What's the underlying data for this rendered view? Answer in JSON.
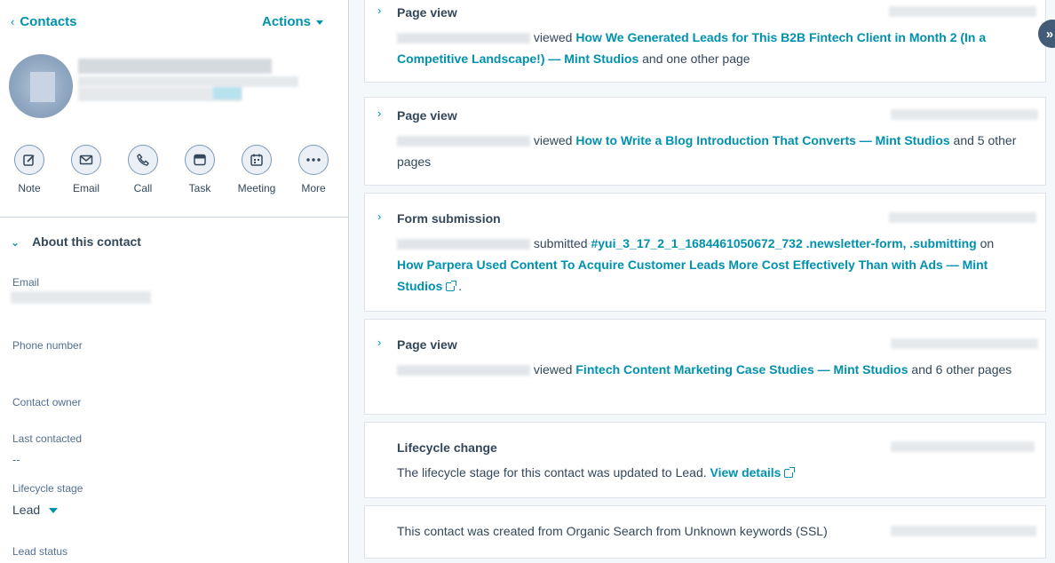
{
  "sidebar": {
    "back_label": "Contacts",
    "actions_label": "Actions",
    "activities": [
      {
        "label": "Note",
        "icon": "note-icon"
      },
      {
        "label": "Email",
        "icon": "email-icon"
      },
      {
        "label": "Call",
        "icon": "call-icon"
      },
      {
        "label": "Task",
        "icon": "task-icon"
      },
      {
        "label": "Meeting",
        "icon": "meeting-icon"
      },
      {
        "label": "More",
        "icon": "more-icon"
      }
    ],
    "about_title": "About this contact",
    "properties": {
      "email_label": "Email",
      "phone_label": "Phone number",
      "owner_label": "Contact owner",
      "last_contacted_label": "Last contacted",
      "last_contacted_value": "--",
      "lifecycle_label": "Lifecycle stage",
      "lifecycle_value": "Lead",
      "lead_status_label": "Lead status"
    }
  },
  "timeline": [
    {
      "title": "Page view",
      "verb": "viewed",
      "link": "How We Generated Leads for This B2B Fintech Client in Month 2 (In a Competitive Landscape!) — Mint Studios",
      "suffix": "and one other page"
    },
    {
      "title": "Page view",
      "verb": "viewed",
      "link": "How to Write a Blog Introduction That Converts — Mint Studios",
      "suffix": "and 5 other pages"
    },
    {
      "title": "Form submission",
      "verb": "submitted",
      "link": "#yui_3_17_2_1_1684461050672_732 .newsletter-form, .submitting",
      "mid": "on",
      "link2": "How Parpera Used Content To Acquire Customer Leads More Cost Effectively Than with Ads — Mint Studios",
      "suffix": "."
    },
    {
      "title": "Page view",
      "verb": "viewed",
      "link": "Fintech Content Marketing Case Studies — Mint Studios",
      "suffix": "and 6 other pages"
    },
    {
      "title": "Lifecycle change",
      "text": "The lifecycle stage for this contact was updated to Lead.",
      "link": "View details"
    },
    {
      "text": "This contact was created from Organic Search from Unknown keywords (SSL)"
    }
  ],
  "colors": {
    "accent": "#0091ae",
    "text": "#33475b",
    "background": "#f5f8fa"
  }
}
